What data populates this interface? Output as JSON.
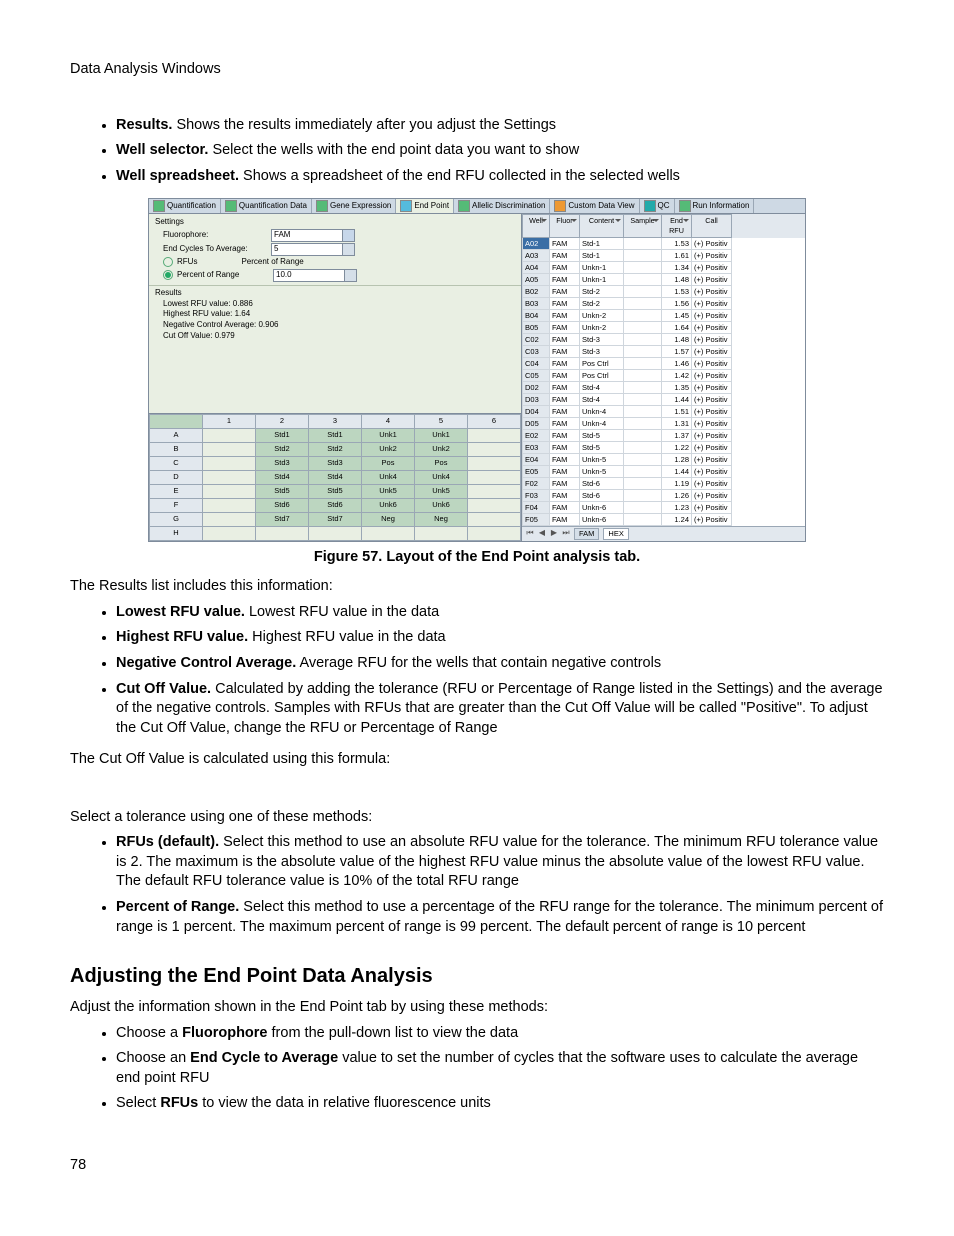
{
  "header": "Data Analysis Windows",
  "page_number": "78",
  "intro_bullets": [
    {
      "term": "Results.",
      "text": " Shows the results immediately after you adjust the Settings"
    },
    {
      "term": "Well selector.",
      "text": " Select the wells with the end point data you want to show"
    },
    {
      "term": "Well spreadsheet.",
      "text": " Shows a spreadsheet of the end RFU collected in the selected wells"
    }
  ],
  "figure": {
    "caption": "Figure 57. Layout of the End Point analysis tab.",
    "tabs": [
      "Quantification",
      "Quantification Data",
      "Gene Expression",
      "End Point",
      "Allelic Discrimination",
      "Custom Data View",
      "QC",
      "Run Information"
    ],
    "active_tab_index": 3,
    "settings": {
      "title": "Settings",
      "fluorophore_label": "Fluorophore:",
      "fluorophore_value": "FAM",
      "end_cycles_label": "End Cycles To Average:",
      "end_cycles_value": "5",
      "rfus_label": "RFUs",
      "percent_label": "Percent of Range",
      "percent_col_label": "Percent of Range",
      "percent_value": "10.0"
    },
    "results": {
      "title": "Results",
      "rows": [
        "Lowest RFU value:   0.886",
        "Highest RFU value:   1.64",
        "Negative Control Average:   0.906",
        "Cut Off Value:   0.979"
      ]
    },
    "selector": {
      "cols": [
        "1",
        "2",
        "3",
        "4",
        "5",
        "6"
      ],
      "rows": [
        "A",
        "B",
        "C",
        "D",
        "E",
        "F",
        "G",
        "H"
      ],
      "cells": {
        "A": [
          "",
          "Std1",
          "Std1",
          "Unk1",
          "Unk1",
          ""
        ],
        "B": [
          "",
          "Std2",
          "Std2",
          "Unk2",
          "Unk2",
          ""
        ],
        "C": [
          "",
          "Std3",
          "Std3",
          "Pos",
          "Pos",
          ""
        ],
        "D": [
          "",
          "Std4",
          "Std4",
          "Unk4",
          "Unk4",
          ""
        ],
        "E": [
          "",
          "Std5",
          "Std5",
          "Unk5",
          "Unk5",
          ""
        ],
        "F": [
          "",
          "Std6",
          "Std6",
          "Unk6",
          "Unk6",
          ""
        ],
        "G": [
          "",
          "Std7",
          "Std7",
          "Neg",
          "Neg",
          ""
        ],
        "H": [
          "",
          "",
          "",
          "",
          "",
          ""
        ]
      }
    },
    "sheet": {
      "headers": [
        "Well",
        "Fluor",
        "Content",
        "Sample",
        "End RFU",
        "Call"
      ],
      "rows": [
        [
          "A02",
          "FAM",
          "Std-1",
          "",
          "1.53",
          "(+) Positiv"
        ],
        [
          "A03",
          "FAM",
          "Std-1",
          "",
          "1.61",
          "(+) Positiv"
        ],
        [
          "A04",
          "FAM",
          "Unkn-1",
          "",
          "1.34",
          "(+) Positiv"
        ],
        [
          "A05",
          "FAM",
          "Unkn-1",
          "",
          "1.48",
          "(+) Positiv"
        ],
        [
          "B02",
          "FAM",
          "Std-2",
          "",
          "1.53",
          "(+) Positiv"
        ],
        [
          "B03",
          "FAM",
          "Std-2",
          "",
          "1.56",
          "(+) Positiv"
        ],
        [
          "B04",
          "FAM",
          "Unkn-2",
          "",
          "1.45",
          "(+) Positiv"
        ],
        [
          "B05",
          "FAM",
          "Unkn-2",
          "",
          "1.64",
          "(+) Positiv"
        ],
        [
          "C02",
          "FAM",
          "Std-3",
          "",
          "1.48",
          "(+) Positiv"
        ],
        [
          "C03",
          "FAM",
          "Std-3",
          "",
          "1.57",
          "(+) Positiv"
        ],
        [
          "C04",
          "FAM",
          "Pos Ctrl",
          "",
          "1.46",
          "(+) Positiv"
        ],
        [
          "C05",
          "FAM",
          "Pos Ctrl",
          "",
          "1.42",
          "(+) Positiv"
        ],
        [
          "D02",
          "FAM",
          "Std-4",
          "",
          "1.35",
          "(+) Positiv"
        ],
        [
          "D03",
          "FAM",
          "Std-4",
          "",
          "1.44",
          "(+) Positiv"
        ],
        [
          "D04",
          "FAM",
          "Unkn-4",
          "",
          "1.51",
          "(+) Positiv"
        ],
        [
          "D05",
          "FAM",
          "Unkn-4",
          "",
          "1.31",
          "(+) Positiv"
        ],
        [
          "E02",
          "FAM",
          "Std-5",
          "",
          "1.37",
          "(+) Positiv"
        ],
        [
          "E03",
          "FAM",
          "Std-5",
          "",
          "1.22",
          "(+) Positiv"
        ],
        [
          "E04",
          "FAM",
          "Unkn-5",
          "",
          "1.28",
          "(+) Positiv"
        ],
        [
          "E05",
          "FAM",
          "Unkn-5",
          "",
          "1.44",
          "(+) Positiv"
        ],
        [
          "F02",
          "FAM",
          "Std-6",
          "",
          "1.19",
          "(+) Positiv"
        ],
        [
          "F03",
          "FAM",
          "Std-6",
          "",
          "1.26",
          "(+) Positiv"
        ],
        [
          "F04",
          "FAM",
          "Unkn-6",
          "",
          "1.23",
          "(+) Positiv"
        ],
        [
          "F05",
          "FAM",
          "Unkn-6",
          "",
          "1.24",
          "(+) Positiv"
        ]
      ],
      "footer_tabs": [
        "FAM",
        "HEX"
      ],
      "nav_first": "⏮",
      "nav_prev": "◀",
      "nav_next": "▶",
      "nav_last": "⏭"
    }
  },
  "after_fig_para": "The Results list includes this information:",
  "results_bullets": [
    {
      "term": "Lowest RFU value.",
      "text": " Lowest RFU value in the data"
    },
    {
      "term": "Highest RFU value.",
      "text": " Highest RFU value in the data"
    },
    {
      "term": "Negative Control Average.",
      "text": " Average RFU for the wells that contain negative controls"
    },
    {
      "term": "Cut Off Value.",
      "text": " Calculated by adding the tolerance (RFU or Percentage of Range listed in the Settings) and the average of the negative controls. Samples with RFUs that are greater than the Cut Off Value will be called \"Positive\". To adjust the Cut Off Value, change the RFU or Percentage of Range"
    }
  ],
  "formula_para": "The Cut Off Value is calculated using this formula:",
  "select_para": "Select a tolerance using one of these methods:",
  "tolerance_bullets": [
    {
      "term": "RFUs (default).",
      "text": " Select this method to use an absolute RFU value for the tolerance. The minimum RFU tolerance value is 2. The maximum is the absolute value of the highest RFU value minus the absolute value of the lowest RFU value. The default RFU tolerance value is 10% of the total RFU range"
    },
    {
      "term": "Percent of Range.",
      "text": " Select this method to use a percentage of the RFU range for the tolerance. The minimum percent of range is 1 percent. The maximum percent of range is 99 percent. The default percent of range is 10 percent"
    }
  ],
  "section_title": "Adjusting the End Point Data Analysis",
  "section_para": "Adjust the information shown in the End Point tab by using these methods:",
  "adjust_bullets": [
    {
      "pre": "Choose a ",
      "term": "Fluorophore",
      "post": " from the pull-down list to view the data"
    },
    {
      "pre": "Choose an ",
      "term": "End Cycle to Average",
      "post": " value to set the number of cycles that the software uses to calculate the average end point RFU"
    },
    {
      "pre": "Select ",
      "term": "RFUs",
      "post": " to view the data in relative fluorescence units"
    }
  ]
}
